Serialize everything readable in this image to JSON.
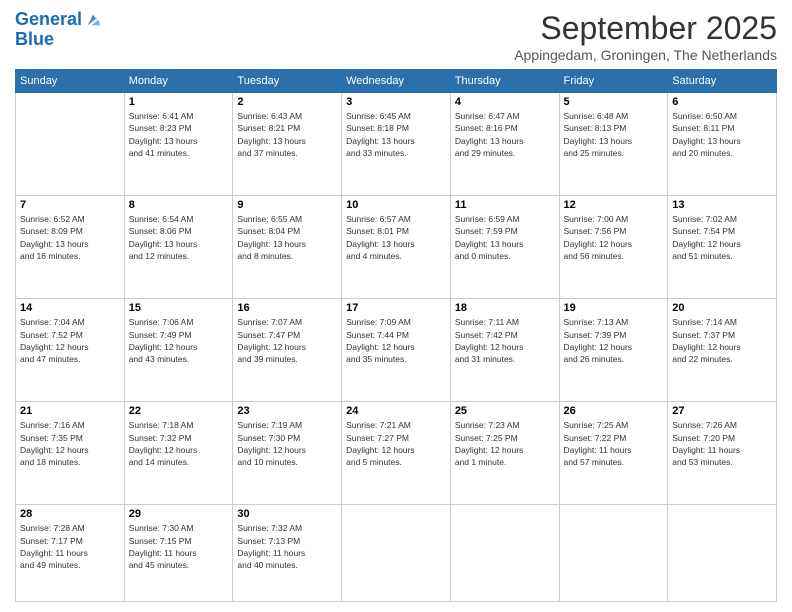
{
  "header": {
    "logo_line1": "General",
    "logo_line2": "Blue",
    "month": "September 2025",
    "location": "Appingedam, Groningen, The Netherlands"
  },
  "weekdays": [
    "Sunday",
    "Monday",
    "Tuesday",
    "Wednesday",
    "Thursday",
    "Friday",
    "Saturday"
  ],
  "weeks": [
    [
      {
        "day": "",
        "info": ""
      },
      {
        "day": "1",
        "info": "Sunrise: 6:41 AM\nSunset: 8:23 PM\nDaylight: 13 hours\nand 41 minutes."
      },
      {
        "day": "2",
        "info": "Sunrise: 6:43 AM\nSunset: 8:21 PM\nDaylight: 13 hours\nand 37 minutes."
      },
      {
        "day": "3",
        "info": "Sunrise: 6:45 AM\nSunset: 8:18 PM\nDaylight: 13 hours\nand 33 minutes."
      },
      {
        "day": "4",
        "info": "Sunrise: 6:47 AM\nSunset: 8:16 PM\nDaylight: 13 hours\nand 29 minutes."
      },
      {
        "day": "5",
        "info": "Sunrise: 6:48 AM\nSunset: 8:13 PM\nDaylight: 13 hours\nand 25 minutes."
      },
      {
        "day": "6",
        "info": "Sunrise: 6:50 AM\nSunset: 8:11 PM\nDaylight: 13 hours\nand 20 minutes."
      }
    ],
    [
      {
        "day": "7",
        "info": "Sunrise: 6:52 AM\nSunset: 8:09 PM\nDaylight: 13 hours\nand 16 minutes."
      },
      {
        "day": "8",
        "info": "Sunrise: 6:54 AM\nSunset: 8:06 PM\nDaylight: 13 hours\nand 12 minutes."
      },
      {
        "day": "9",
        "info": "Sunrise: 6:55 AM\nSunset: 8:04 PM\nDaylight: 13 hours\nand 8 minutes."
      },
      {
        "day": "10",
        "info": "Sunrise: 6:57 AM\nSunset: 8:01 PM\nDaylight: 13 hours\nand 4 minutes."
      },
      {
        "day": "11",
        "info": "Sunrise: 6:59 AM\nSunset: 7:59 PM\nDaylight: 13 hours\nand 0 minutes."
      },
      {
        "day": "12",
        "info": "Sunrise: 7:00 AM\nSunset: 7:56 PM\nDaylight: 12 hours\nand 56 minutes."
      },
      {
        "day": "13",
        "info": "Sunrise: 7:02 AM\nSunset: 7:54 PM\nDaylight: 12 hours\nand 51 minutes."
      }
    ],
    [
      {
        "day": "14",
        "info": "Sunrise: 7:04 AM\nSunset: 7:52 PM\nDaylight: 12 hours\nand 47 minutes."
      },
      {
        "day": "15",
        "info": "Sunrise: 7:06 AM\nSunset: 7:49 PM\nDaylight: 12 hours\nand 43 minutes."
      },
      {
        "day": "16",
        "info": "Sunrise: 7:07 AM\nSunset: 7:47 PM\nDaylight: 12 hours\nand 39 minutes."
      },
      {
        "day": "17",
        "info": "Sunrise: 7:09 AM\nSunset: 7:44 PM\nDaylight: 12 hours\nand 35 minutes."
      },
      {
        "day": "18",
        "info": "Sunrise: 7:11 AM\nSunset: 7:42 PM\nDaylight: 12 hours\nand 31 minutes."
      },
      {
        "day": "19",
        "info": "Sunrise: 7:13 AM\nSunset: 7:39 PM\nDaylight: 12 hours\nand 26 minutes."
      },
      {
        "day": "20",
        "info": "Sunrise: 7:14 AM\nSunset: 7:37 PM\nDaylight: 12 hours\nand 22 minutes."
      }
    ],
    [
      {
        "day": "21",
        "info": "Sunrise: 7:16 AM\nSunset: 7:35 PM\nDaylight: 12 hours\nand 18 minutes."
      },
      {
        "day": "22",
        "info": "Sunrise: 7:18 AM\nSunset: 7:32 PM\nDaylight: 12 hours\nand 14 minutes."
      },
      {
        "day": "23",
        "info": "Sunrise: 7:19 AM\nSunset: 7:30 PM\nDaylight: 12 hours\nand 10 minutes."
      },
      {
        "day": "24",
        "info": "Sunrise: 7:21 AM\nSunset: 7:27 PM\nDaylight: 12 hours\nand 5 minutes."
      },
      {
        "day": "25",
        "info": "Sunrise: 7:23 AM\nSunset: 7:25 PM\nDaylight: 12 hours\nand 1 minute."
      },
      {
        "day": "26",
        "info": "Sunrise: 7:25 AM\nSunset: 7:22 PM\nDaylight: 11 hours\nand 57 minutes."
      },
      {
        "day": "27",
        "info": "Sunrise: 7:26 AM\nSunset: 7:20 PM\nDaylight: 11 hours\nand 53 minutes."
      }
    ],
    [
      {
        "day": "28",
        "info": "Sunrise: 7:28 AM\nSunset: 7:17 PM\nDaylight: 11 hours\nand 49 minutes."
      },
      {
        "day": "29",
        "info": "Sunrise: 7:30 AM\nSunset: 7:15 PM\nDaylight: 11 hours\nand 45 minutes."
      },
      {
        "day": "30",
        "info": "Sunrise: 7:32 AM\nSunset: 7:13 PM\nDaylight: 11 hours\nand 40 minutes."
      },
      {
        "day": "",
        "info": ""
      },
      {
        "day": "",
        "info": ""
      },
      {
        "day": "",
        "info": ""
      },
      {
        "day": "",
        "info": ""
      }
    ]
  ]
}
